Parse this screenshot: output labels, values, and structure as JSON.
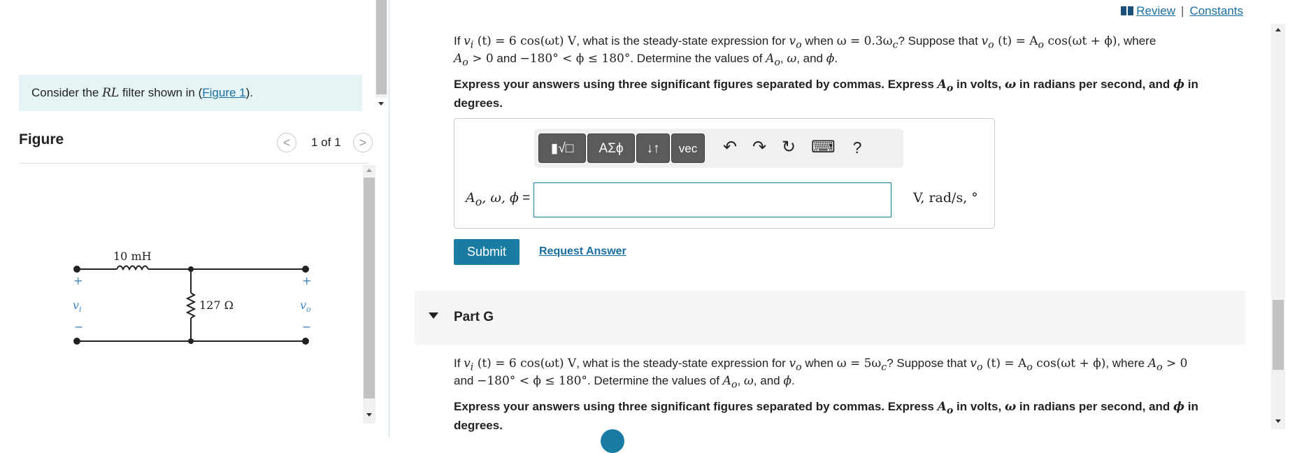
{
  "left": {
    "consider": {
      "prefix": "Consider the ",
      "symbol": "RL",
      "mid": " filter shown in (",
      "link": "Figure 1",
      "suffix": ")."
    },
    "figure": {
      "title": "Figure",
      "count": "1 of 1",
      "prev_glyph": "<",
      "next_glyph": ">"
    },
    "circuit": {
      "inductor_label": "10 mH",
      "resistor_label": "127 Ω",
      "input_label": "v",
      "input_sub": "i",
      "output_label": "v",
      "output_sub": "o",
      "plus": "+",
      "minus": "−"
    }
  },
  "top_links": {
    "review": "Review",
    "separator": "|",
    "constants": "Constants"
  },
  "part_f": {
    "question_line1_a": "If ",
    "question_line1_b": "v",
    "question_line1_c": "i",
    "question_line1_d": " (t) = 6 cos(ωt) V",
    "question_line1_e": ", what is the steady-state expression for ",
    "question_line1_f": "v",
    "question_line1_g": "o",
    "question_line1_h": " when ",
    "question_line1_i": "ω = 0.3ω",
    "question_line1_j": "c",
    "question_line1_k": "? Suppose that ",
    "question_line1_l": "v",
    "question_line1_m": "o",
    "question_line1_n": " (t) = A",
    "question_line1_o": "o",
    "question_line1_p": " cos(ωt + ϕ)",
    "question_line1_q": ", where",
    "question_line2_a": "A",
    "question_line2_b": "o",
    "question_line2_c": " > 0",
    "question_line2_d": " and ",
    "question_line2_e": "−180° < ϕ ≤ 180°",
    "question_line2_f": ". Determine the values of ",
    "question_line2_g": "A",
    "question_line2_h": "o",
    "question_line2_i": ", ",
    "question_line2_j": "ω",
    "question_line2_k": ", and ",
    "question_line2_l": "ϕ",
    "question_line2_m": ".",
    "instructions_line1_a": "Express your answers using three significant figures separated by commas. Express ",
    "instructions_line1_b": "A",
    "instructions_line1_c": "o",
    "instructions_line1_d": " in volts, ",
    "instructions_line1_e": "ω",
    "instructions_line1_f": " in radians per second, and ",
    "instructions_line1_g": "ϕ",
    "instructions_line1_h": " in",
    "instructions_line2": "degrees."
  },
  "toolbar": {
    "templates": "▮√□",
    "greek": "ΑΣϕ",
    "subsup": "↓↑",
    "vec": "vec",
    "undo": "↶",
    "redo": "↷",
    "reset": "↻",
    "keyboard": "⌨",
    "help": "?"
  },
  "answer": {
    "label_a": "A",
    "label_b": "o",
    "label_c": ", ω, ϕ",
    "label_eq": " =",
    "value": "",
    "units": "V, rad/s, °"
  },
  "actions": {
    "submit": "Submit",
    "request_answer": "Request Answer"
  },
  "part_g": {
    "title": "Part G",
    "question_line1_a": "If ",
    "question_line1_b": "v",
    "question_line1_c": "i",
    "question_line1_d": " (t) = 6 cos(ωt) V",
    "question_line1_e": ", what is the steady-state expression for ",
    "question_line1_f": "v",
    "question_line1_g": "o",
    "question_line1_h": " when ",
    "question_line1_i": "ω = 5ω",
    "question_line1_j": "c",
    "question_line1_k": "? Suppose that ",
    "question_line1_l": "v",
    "question_line1_m": "o",
    "question_line1_n": " (t) = A",
    "question_line1_o": "o",
    "question_line1_p": " cos(ωt + ϕ)",
    "question_line1_q": ", where ",
    "question_line1_r": "A",
    "question_line1_s": "o",
    "question_line1_t": " > 0",
    "question_line2_a": "and ",
    "question_line2_b": "−180° < ϕ ≤ 180°",
    "question_line2_c": ". Determine the values of ",
    "question_line2_d": "A",
    "question_line2_e": "o",
    "question_line2_f": ", ",
    "question_line2_g": "ω",
    "question_line2_h": ", and ",
    "question_line2_i": "ϕ",
    "question_line2_j": ".",
    "instructions_line1_a": "Express your answers using three significant figures separated by commas. Express ",
    "instructions_line1_b": "A",
    "instructions_line1_c": "o",
    "instructions_line1_d": " in volts, ",
    "instructions_line1_e": "ω",
    "instructions_line1_f": " in radians per second, and ",
    "instructions_line1_g": "ϕ",
    "instructions_line1_h": " in",
    "instructions_line2": "degrees."
  },
  "colors": {
    "accent": "#1a7ba3",
    "consider_bg": "#e6f4f6",
    "toolbar_button": "#5b5b5b",
    "part_header_bg": "#f5f5f5"
  }
}
